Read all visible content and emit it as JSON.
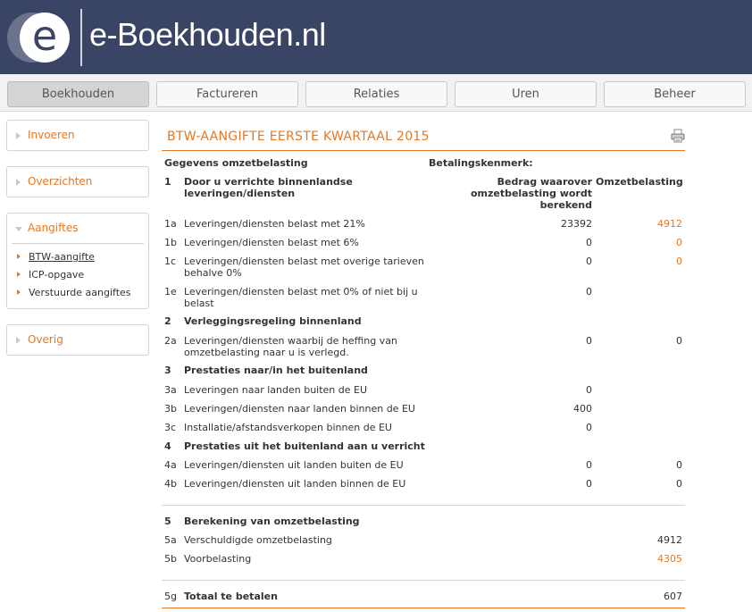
{
  "header": {
    "logo_letter": "e",
    "logo_text": "e-Boekhouden.nl"
  },
  "nav": {
    "tabs": [
      {
        "label": "Boekhouden",
        "active": true
      },
      {
        "label": "Factureren",
        "active": false
      },
      {
        "label": "Relaties",
        "active": false
      },
      {
        "label": "Uren",
        "active": false
      },
      {
        "label": "Beheer",
        "active": false
      }
    ]
  },
  "sidebar": {
    "invoeren": "Invoeren",
    "overzichten": "Overzichten",
    "aangiftes": {
      "label": "Aangiftes",
      "items": [
        "BTW-aangifte",
        "ICP-opgave",
        "Verstuurde aangiftes"
      ]
    },
    "overig": "Overig"
  },
  "main": {
    "title": "BTW-AANGIFTE EERSTE KWARTAAL 2015",
    "gegevens_label": "Gegevens omzetbelasting",
    "betalingskenmerk_label": "Betalingskenmerk:",
    "col_amount_header": "Bedrag waarover omzetbelasting wordt berekend",
    "col_tax_header": "Omzetbelasting",
    "sections": [
      {
        "code": "1",
        "title": "Door u verrichte binnenlandse leveringen/diensten"
      },
      {
        "code": "2",
        "title": "Verleggingsregeling binnenland"
      },
      {
        "code": "3",
        "title": "Prestaties naar/in het buitenland"
      },
      {
        "code": "4",
        "title": "Prestaties uit het buitenland aan u verricht"
      },
      {
        "code": "5",
        "title": "Berekening van omzetbelasting"
      }
    ],
    "rows": {
      "r1a": {
        "code": "1a",
        "desc": "Leveringen/diensten belast met 21%",
        "amount": "23392",
        "tax": "4912"
      },
      "r1b": {
        "code": "1b",
        "desc": "Leveringen/diensten belast met 6%",
        "amount": "0",
        "tax": "0"
      },
      "r1c": {
        "code": "1c",
        "desc": "Leveringen/diensten belast met overige tarieven behalve 0%",
        "amount": "0",
        "tax": "0"
      },
      "r1e": {
        "code": "1e",
        "desc": "Leveringen/diensten belast met 0% of niet bij u belast",
        "amount": "0",
        "tax": ""
      },
      "r2a": {
        "code": "2a",
        "desc": "Leveringen/diensten waarbij de heffing van omzetbelasting naar u is verlegd.",
        "amount": "0",
        "tax": "0"
      },
      "r3a": {
        "code": "3a",
        "desc": "Leveringen naar landen buiten de EU",
        "amount": "0",
        "tax": ""
      },
      "r3b": {
        "code": "3b",
        "desc": "Leveringen/diensten naar landen binnen de EU",
        "amount": "400",
        "tax": ""
      },
      "r3c": {
        "code": "3c",
        "desc": "Installatie/afstandsverkopen binnen de EU",
        "amount": "0",
        "tax": ""
      },
      "r4a": {
        "code": "4a",
        "desc": "Leveringen/diensten uit landen buiten de EU",
        "amount": "0",
        "tax": "0"
      },
      "r4b": {
        "code": "4b",
        "desc": "Leveringen/diensten uit landen binnen de EU",
        "amount": "0",
        "tax": "0"
      },
      "r5a": {
        "code": "5a",
        "desc": "Verschuldigde omzetbelasting",
        "amount": "",
        "tax": "4912"
      },
      "r5b": {
        "code": "5b",
        "desc": "Voorbelasting",
        "amount": "",
        "tax": "4305"
      },
      "r5g": {
        "code": "5g",
        "desc": "Totaal te betalen",
        "amount": "",
        "tax": "607"
      }
    }
  }
}
